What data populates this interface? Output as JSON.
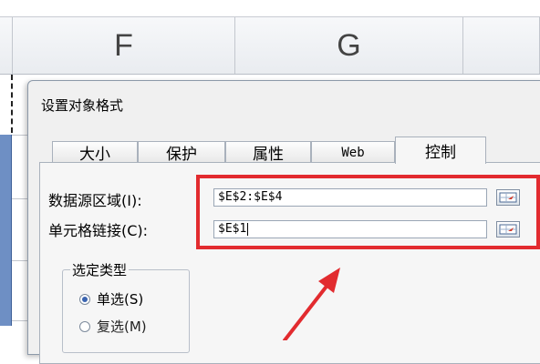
{
  "sheet": {
    "columns": [
      "F",
      "G"
    ]
  },
  "dialog": {
    "title": "设置对象格式",
    "tabs": [
      {
        "label": "大小",
        "active": false
      },
      {
        "label": "保护",
        "active": false
      },
      {
        "label": "属性",
        "active": false
      },
      {
        "label": "Web",
        "active": false
      },
      {
        "label": "控制",
        "active": true
      }
    ],
    "fields": {
      "input_range_label": "数据源区域(I):",
      "input_range_value": "$E$2:$E$4",
      "cell_link_label": "单元格链接(C):",
      "cell_link_value": "$E$1"
    },
    "selection_type": {
      "title": "选定类型",
      "options": [
        {
          "label": "单选(S)",
          "selected": true
        },
        {
          "label": "复选(M)",
          "selected": false
        }
      ]
    }
  },
  "colors": {
    "highlight": "#e22b2f",
    "arrow": "#e22b2f",
    "selection": "#6e8fc4"
  },
  "icons": [
    "range-picker-icon",
    "range-picker-icon",
    "annotation-arrow-icon"
  ]
}
